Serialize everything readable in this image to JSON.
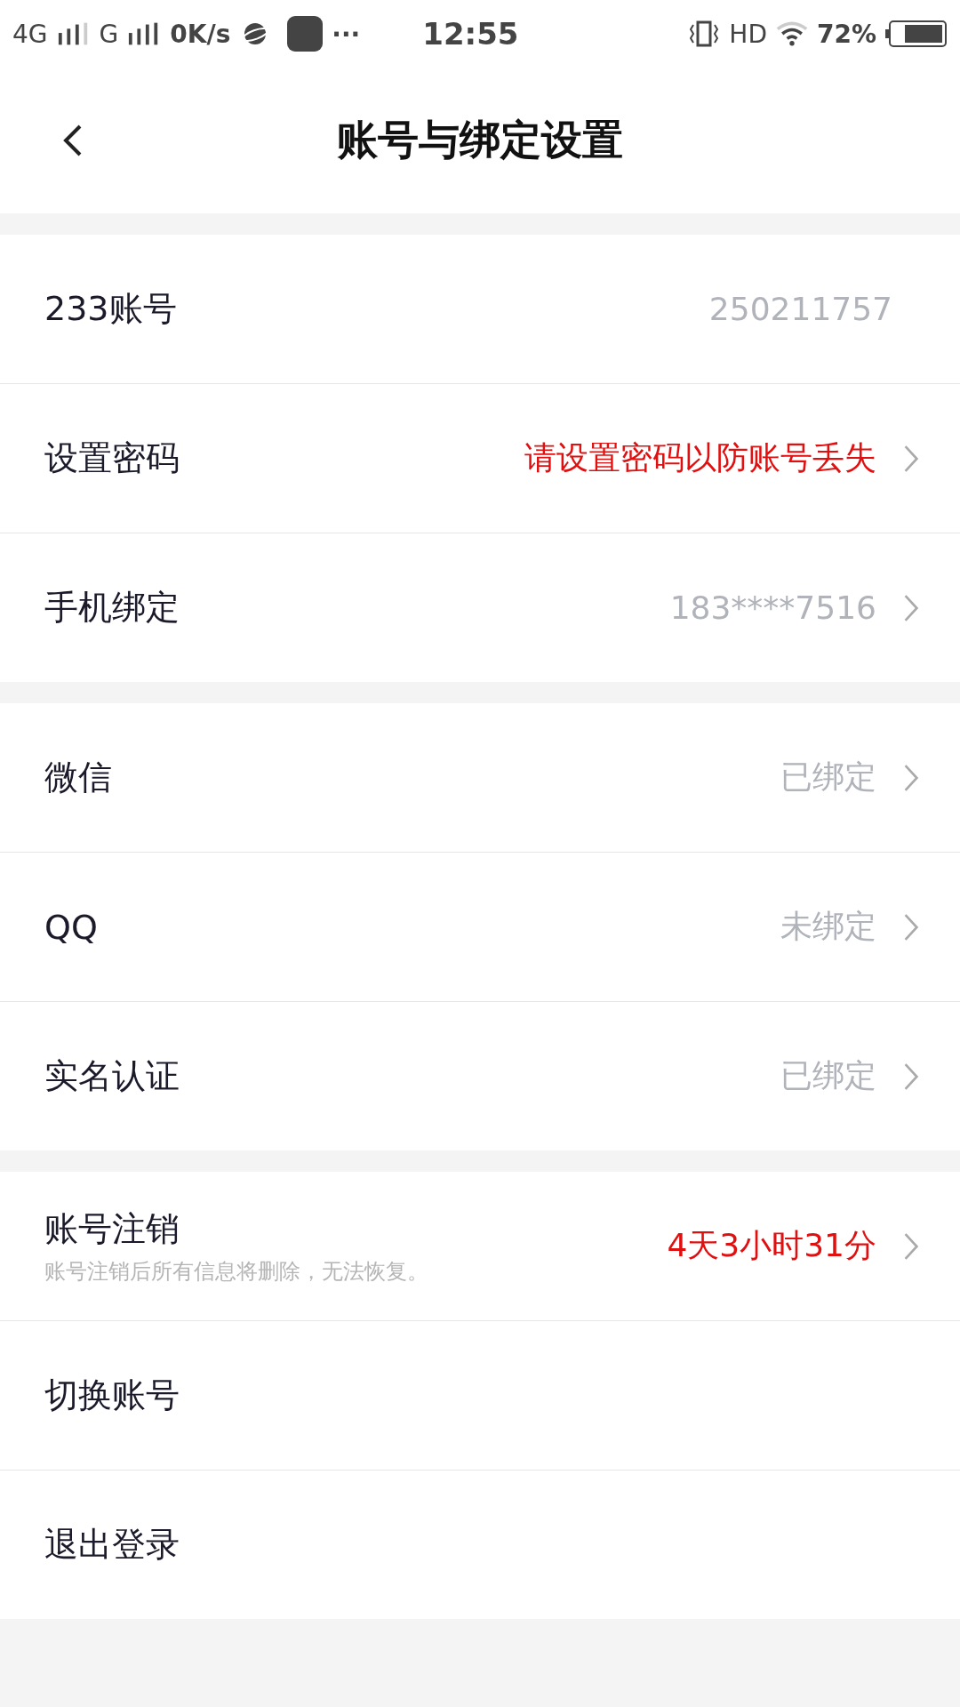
{
  "status_bar": {
    "network_1": "4G",
    "network_2": "G",
    "speed": "0K/s",
    "more": "···",
    "time": "12:55",
    "hd": "HD",
    "battery": "72%"
  },
  "header": {
    "title": "账号与绑定设置"
  },
  "sections": [
    {
      "rows": [
        {
          "label": "233账号",
          "value": "250211757",
          "highlight": false,
          "chevron": false
        },
        {
          "label": "设置密码",
          "value": "请设置密码以防账号丢失",
          "highlight": true,
          "chevron": true
        },
        {
          "label": "手机绑定",
          "value": "183****7516",
          "highlight": false,
          "chevron": true
        }
      ]
    },
    {
      "rows": [
        {
          "label": "微信",
          "value": "已绑定",
          "highlight": false,
          "chevron": true
        },
        {
          "label": "QQ",
          "value": "未绑定",
          "highlight": false,
          "chevron": true
        },
        {
          "label": "实名认证",
          "value": "已绑定",
          "highlight": false,
          "chevron": true
        }
      ]
    },
    {
      "rows": [
        {
          "label": "账号注销",
          "subtitle": "账号注销后所有信息将删除，无法恢复。",
          "value": "4天3小时31分",
          "highlight": true,
          "chevron": true
        },
        {
          "label": "切换账号",
          "chevron": false
        },
        {
          "label": "退出登录",
          "chevron": false
        }
      ]
    }
  ]
}
